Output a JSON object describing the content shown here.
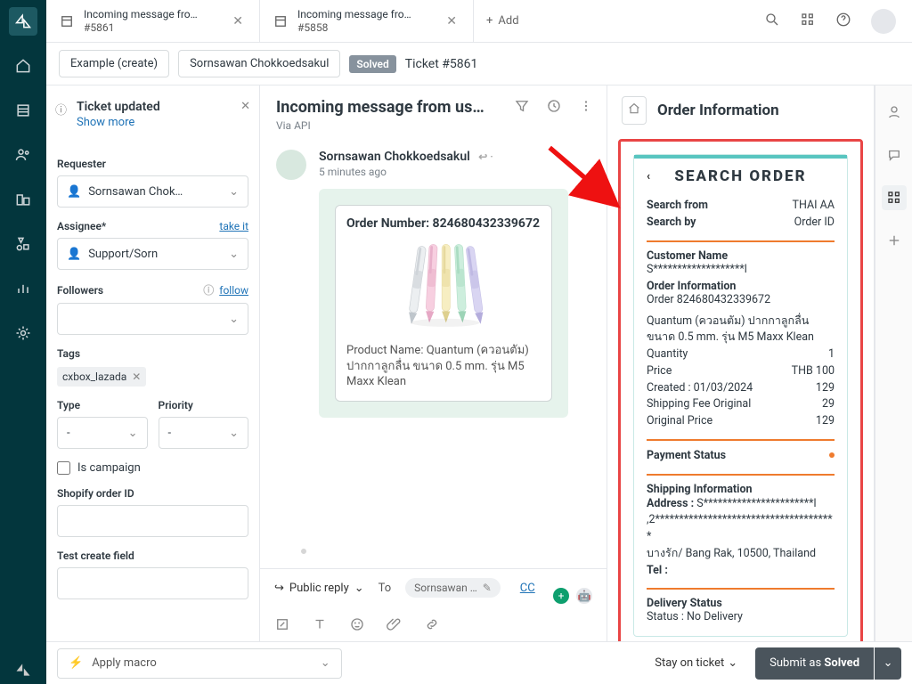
{
  "tabs": [
    {
      "title": "Incoming message fro…",
      "sub": "#5861"
    },
    {
      "title": "Incoming message fro…",
      "sub": "#5858"
    }
  ],
  "addTab": "Add",
  "crumbs": {
    "example": "Example (create)",
    "person": "Sornsawan Chokkoedsakul",
    "status": "Solved",
    "ticket": "Ticket #5861"
  },
  "notice": {
    "title": "Ticket updated",
    "link": "Show more"
  },
  "props": {
    "requesterLabel": "Requester",
    "requesterValue": "Sornsawan Chok…",
    "assigneeLabel": "Assignee*",
    "assigneeLink": "take it",
    "assigneeValue": "Support/Sorn",
    "followersLabel": "Followers",
    "followersLink": "follow",
    "followersValue": "",
    "tagsLabel": "Tags",
    "tagChip": "cxbox_lazada",
    "typeLabel": "Type",
    "typeValue": "-",
    "priorityLabel": "Priority",
    "priorityValue": "-",
    "campaign": "Is campaign",
    "shopifyLabel": "Shopify order ID",
    "testLabel": "Test create field"
  },
  "convo": {
    "title": "Incoming message from us…",
    "via": "Via API",
    "author": "Sornsawan Chokkoedsakul",
    "time": "5 minutes ago",
    "card": {
      "orderLabel": "Order Number:",
      "orderValue": "824680432339672",
      "productLabel": "Product Name:",
      "productValue": "Quantum (ควอนตัม) ปากกาลูกลื่น ขนาด 0.5 mm. รุ่น M5 Maxx Klean"
    },
    "reply": {
      "publicReply": "Public reply",
      "to": "To",
      "recipient": "Sornsawan …",
      "cc": "CC"
    }
  },
  "rpanel": {
    "heading": "Order Information",
    "appTitle": "SEARCH ORDER",
    "searchFromK": "Search from",
    "searchFromV": "THAI AA",
    "searchByK": "Search by",
    "searchByV": "Order ID",
    "custNameK": "Customer Name",
    "custNameV": "S*******************l",
    "orderInfoK": "Order Information",
    "orderInfoV": "Order 824680432339672",
    "productLine": "Quantum (ควอนตัม) ปากกาลูกลื่น ขนาด 0.5 mm. รุ่น M5 Maxx Klean",
    "qtyK": "Quantity",
    "qtyV": "1",
    "priceK": "Price",
    "priceV": "THB 100",
    "createdK": "Created : 01/03/2024",
    "createdV": "129",
    "shipFeeK": "Shipping Fee Original",
    "shipFeeV": "29",
    "origPriceK": "Original Price",
    "origPriceV": "129",
    "paymentK": "Payment Status",
    "shipInfoK": "Shipping Information",
    "addrK": "Address :",
    "addrLine1": "S***********************l",
    "addrLine2": ",2**************************************",
    "addrLine3": "บางรัก/ Bang Rak, 10500, Thailand",
    "telK": "Tel :",
    "delK": "Delivery Status",
    "delV": "Status : No Delivery"
  },
  "footer": {
    "macro": "Apply macro",
    "stay": "Stay on ticket",
    "submitPrefix": "Submit as ",
    "submitStatus": "Solved"
  }
}
